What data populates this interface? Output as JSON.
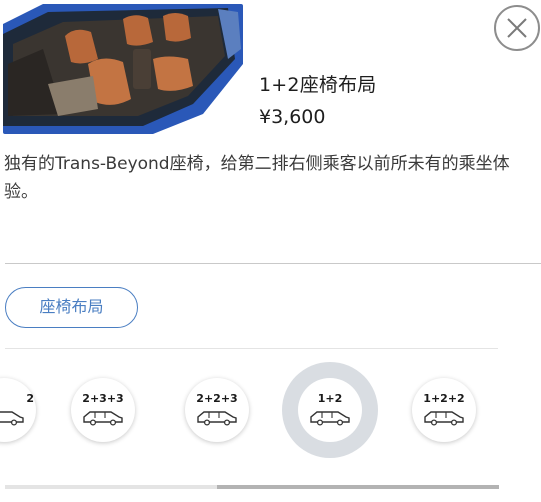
{
  "option": {
    "name": "1+2座椅布局",
    "price": "¥3,600",
    "description": "独有的Trans-Beyond座椅，给第二排右侧乘客以前所未有的乘坐体验。",
    "image_icon": "car-interior-photo"
  },
  "close_icon": "close-icon",
  "category_tab": {
    "label": "座椅布局"
  },
  "seat_layouts": [
    {
      "label": "2",
      "selected": false
    },
    {
      "label": "2+3+3",
      "selected": false
    },
    {
      "label": "2+2+3",
      "selected": false
    },
    {
      "label": "1+2",
      "selected": true
    },
    {
      "label": "1+2+2",
      "selected": false
    }
  ],
  "colors": {
    "accent": "#4a7ec2",
    "selected_ring": "#d9dde2"
  }
}
